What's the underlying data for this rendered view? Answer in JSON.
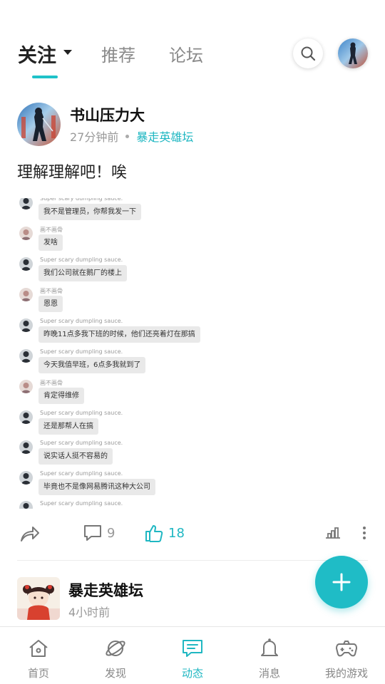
{
  "header": {
    "tabs": [
      {
        "label": "关注",
        "active": true
      },
      {
        "label": "推荐",
        "active": false
      },
      {
        "label": "论坛",
        "active": false
      }
    ],
    "accent": "#1fc2c9"
  },
  "post": {
    "author": "书山压力大",
    "time": "27分钟前",
    "forum": "暴走英雄坛",
    "text": "理解理解吧！唉",
    "comments": "9",
    "likes": "18"
  },
  "chat": {
    "messages": [
      {
        "name": "Super scary dumpling sauce.",
        "text": "我不是管理员，你帮我发一下",
        "avatar": "dark"
      },
      {
        "name": "画不画骨",
        "text": "发啥",
        "avatar": "light"
      },
      {
        "name": "Super scary dumpling sauce.",
        "text": "我们公司就在鹅厂的楼上",
        "avatar": "dark"
      },
      {
        "name": "画不画骨",
        "text": "恩恩",
        "avatar": "light"
      },
      {
        "name": "Super scary dumpling sauce.",
        "text": "昨晚11点多我下班的时候，他们还亮着灯在那搞",
        "avatar": "dark"
      },
      {
        "name": "Super scary dumpling sauce.",
        "text": "今天我值早班，6点多我就到了",
        "avatar": "dark"
      },
      {
        "name": "画不画骨",
        "text": "肯定得维修",
        "avatar": "light"
      },
      {
        "name": "Super scary dumpling sauce.",
        "text": "还是那帮人在搞",
        "avatar": "dark"
      },
      {
        "name": "Super scary dumpling sauce.",
        "text": "说实话人挺不容易的",
        "avatar": "dark"
      },
      {
        "name": "Super scary dumpling sauce.",
        "text": "毕竟也不是像网易腾讯这种大公司",
        "avatar": "dark"
      },
      {
        "name": "Super scary dumpling sauce.",
        "text": "",
        "avatar": "dark"
      }
    ]
  },
  "post2": {
    "author": "暴走英雄坛",
    "time": "4小时前"
  },
  "nav": {
    "items": [
      {
        "label": "首页",
        "icon": "home-icon"
      },
      {
        "label": "发现",
        "icon": "planet-icon"
      },
      {
        "label": "动态",
        "icon": "message-icon",
        "active": true
      },
      {
        "label": "消息",
        "icon": "bell-icon"
      },
      {
        "label": "我的游戏",
        "icon": "gamepad-icon"
      }
    ]
  }
}
